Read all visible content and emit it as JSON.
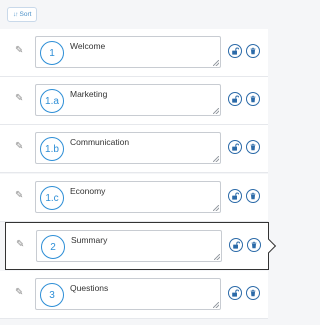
{
  "toolbar": {
    "sort_label": "Sort",
    "sort_icon": "sort-icon"
  },
  "items": [
    {
      "number": "1",
      "title": "Welcome",
      "selected": false
    },
    {
      "number": "1.a",
      "title": "Marketing",
      "selected": false
    },
    {
      "number": "1.b",
      "title": "Communication",
      "selected": false
    },
    {
      "number": "1.c",
      "title": "Economy",
      "selected": false
    },
    {
      "number": "2",
      "title": "Summary",
      "selected": true
    },
    {
      "number": "3",
      "title": "Questions",
      "selected": false
    }
  ],
  "colors": {
    "accent": "#2d8ed6",
    "button_border": "#2b6aa8",
    "background": "#f5f6f8"
  }
}
